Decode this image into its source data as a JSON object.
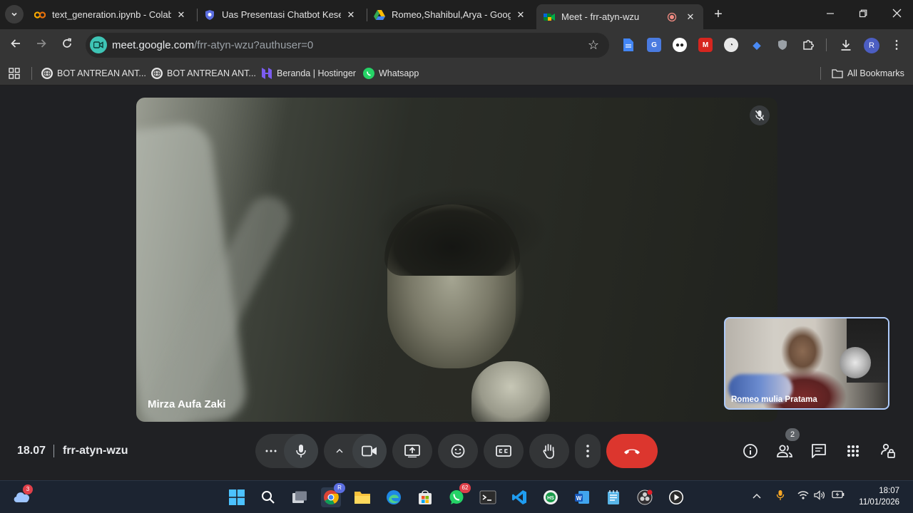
{
  "browser": {
    "tabs": [
      {
        "title": "text_generation.ipynb - Colab",
        "icon": "colab-icon"
      },
      {
        "title": "Uas Presentasi Chatbot Kesehat",
        "icon": "shield-icon"
      },
      {
        "title": "Romeo,Shahibul,Arya - Google",
        "icon": "google-drive-icon"
      },
      {
        "title": "Meet - frr-atyn-wzu",
        "icon": "google-meet-icon",
        "active": true,
        "recording": true
      }
    ],
    "url_host": "meet.google.com",
    "url_path": "/frr-atyn-wzu?authuser=0",
    "profile_initial": "R",
    "bookmarks": [
      {
        "label": "BOT ANTREAN ANT...",
        "icon": "globe-icon"
      },
      {
        "label": "BOT ANTREAN ANT...",
        "icon": "globe-icon"
      },
      {
        "label": "Beranda | Hostinger",
        "icon": "hostinger-icon"
      },
      {
        "label": "Whatsapp",
        "icon": "whatsapp-icon"
      }
    ],
    "all_bookmarks_label": "All Bookmarks"
  },
  "meet": {
    "main_participant": "Mirza Aufa Zaki",
    "self_participant": "Romeo mulia Pratama",
    "time": "18.07",
    "meeting_code": "frr-atyn-wzu",
    "participant_count": "2"
  },
  "taskbar": {
    "weather_badge": "3",
    "chrome_badge": "R",
    "whatsapp_badge": "62",
    "time": "18:07",
    "date": "11/01/2026"
  },
  "colors": {
    "end_call": "#dc362e",
    "meet_bg": "#202124",
    "self_tile_border": "#aecbfa",
    "accent": "#3ec4b5"
  }
}
